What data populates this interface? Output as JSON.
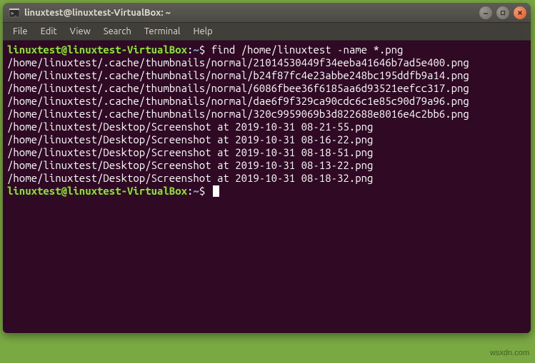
{
  "window": {
    "title": "linuxtest@linuxtest-VirtualBox: ~"
  },
  "menubar": {
    "items": [
      "File",
      "Edit",
      "View",
      "Search",
      "Terminal",
      "Help"
    ]
  },
  "terminal": {
    "prompt_user": "linuxtest@linuxtest-VirtualBox",
    "prompt_sep1": ":",
    "prompt_path": "~",
    "prompt_sep2": "$ ",
    "command": "find /home/linuxtest -name *.png",
    "output": [
      "/home/linuxtest/.cache/thumbnails/normal/21014530449f34eeba41646b7ad5e400.png",
      "/home/linuxtest/.cache/thumbnails/normal/b24f87fc4e23abbe248bc195ddfb9a14.png",
      "/home/linuxtest/.cache/thumbnails/normal/6086fbee36f6185aa6d93521eefcc317.png",
      "/home/linuxtest/.cache/thumbnails/normal/dae6f9f329ca90cdc6c1e85c90d79a96.png",
      "/home/linuxtest/.cache/thumbnails/normal/320c9959069b3d822688e8016e4c2bb6.png",
      "/home/linuxtest/Desktop/Screenshot at 2019-10-31 08-21-55.png",
      "/home/linuxtest/Desktop/Screenshot at 2019-10-31 08-16-22.png",
      "/home/linuxtest/Desktop/Screenshot at 2019-10-31 08-18-51.png",
      "/home/linuxtest/Desktop/Screenshot at 2019-10-31 08-13-22.png",
      "/home/linuxtest/Desktop/Screenshot at 2019-10-31 08-18-32.png"
    ]
  },
  "watermark": "wsxdn.com"
}
